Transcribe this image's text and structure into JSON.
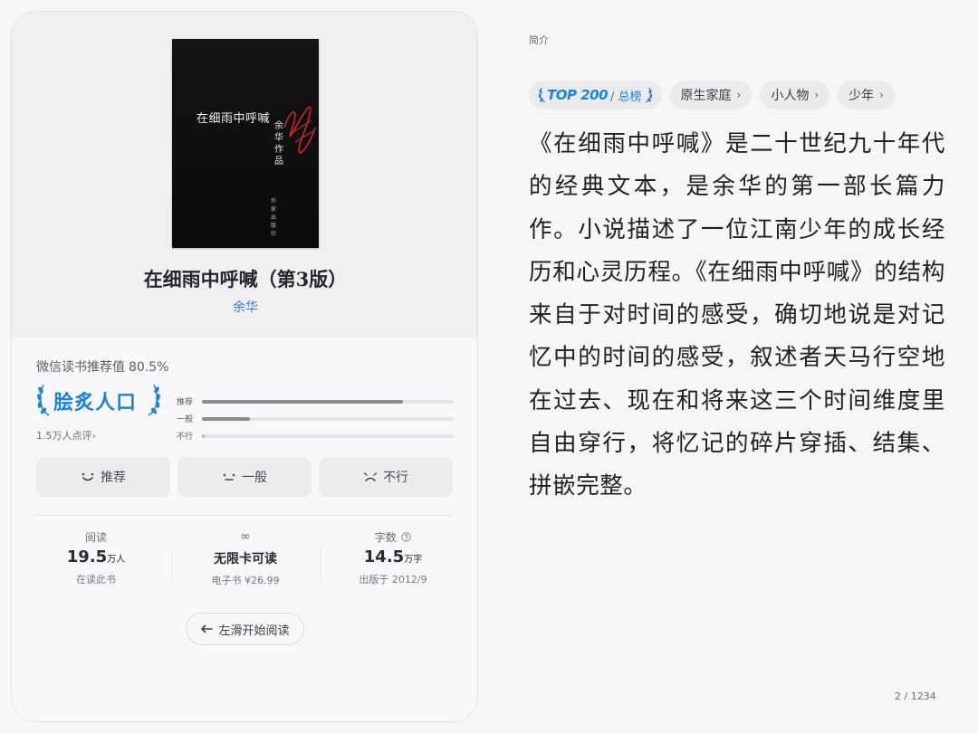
{
  "book": {
    "title": "在细雨中呼喊（第3版）",
    "author": "余华",
    "cover": {
      "title": "在细雨中呼喊",
      "author_vertical": "余华作品",
      "publisher_vertical": "作家出版社"
    }
  },
  "rating": {
    "label": "微信读书推荐值",
    "percent": "80.5%",
    "badge": "脍炙人口",
    "review_count": "1.5万人点评",
    "bars": [
      {
        "label": "推荐",
        "fill": 0.8
      },
      {
        "label": "一般",
        "fill": 0.19
      },
      {
        "label": "不行",
        "fill": 0.01
      }
    ]
  },
  "vote_buttons": [
    {
      "label": "推荐",
      "icon": "smile-icon"
    },
    {
      "label": "一般",
      "icon": "neutral-face-icon"
    },
    {
      "label": "不行",
      "icon": "frown-icon"
    }
  ],
  "stats": {
    "read": {
      "label": "阅读",
      "value": "19.5",
      "unit": "万人",
      "sub": "在读此书"
    },
    "card": {
      "icon": "infinity-icon",
      "value": "无限卡可读",
      "sub": "电子书 ¥26.99"
    },
    "words": {
      "label": "字数",
      "value": "14.5",
      "unit": "万字",
      "sub": "出版于 2012/9"
    }
  },
  "start_read": "左滑开始阅读",
  "intro": {
    "label": "简介",
    "tags": [
      {
        "main": "TOP 200",
        "sub": "/ 总榜",
        "color": "#1b84d9"
      },
      {
        "label": "原生家庭"
      },
      {
        "label": "小人物"
      },
      {
        "label": "少年"
      }
    ],
    "synopsis": "《在细雨中呼喊》是二十世纪九十年代的经典文本，是余华的第一部长篇力作。小说描述了一位江南少年的成长经历和心灵历程。《在细雨中呼喊》的结构来自于对时间的感受，确切地说是对记忆中的时间的感受，叙述者天马行空地在过去、现在和将来这三个时间维度里自由穿行，将忆记的碎片穿插、结集、拼嵌完整。"
  },
  "page": "2 / 1234"
}
